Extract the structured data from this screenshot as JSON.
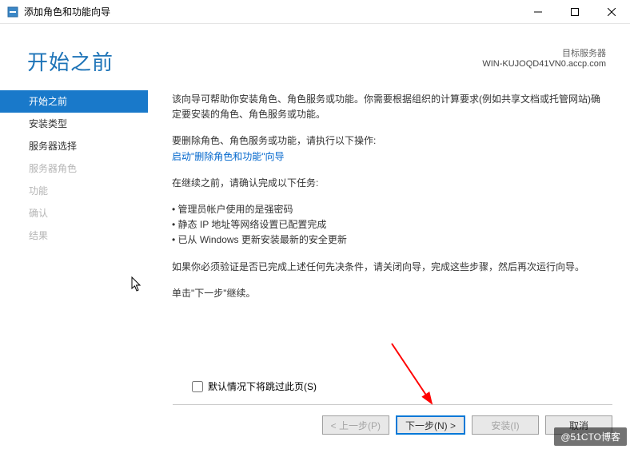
{
  "window": {
    "title": "添加角色和功能向导"
  },
  "header": {
    "page_title": "开始之前",
    "server_label": "目标服务器",
    "server_name": "WIN-KUJOQD41VN0.accp.com"
  },
  "sidebar": {
    "items": [
      {
        "label": "开始之前",
        "state": "active"
      },
      {
        "label": "安装类型",
        "state": "normal"
      },
      {
        "label": "服务器选择",
        "state": "normal"
      },
      {
        "label": "服务器角色",
        "state": "disabled"
      },
      {
        "label": "功能",
        "state": "disabled"
      },
      {
        "label": "确认",
        "state": "disabled"
      },
      {
        "label": "结果",
        "state": "disabled"
      }
    ]
  },
  "content": {
    "intro": "该向导可帮助你安装角色、角色服务或功能。你需要根据组织的计算要求(例如共享文档或托管网站)确定要安装的角色、角色服务或功能。",
    "remove_label": "要删除角色、角色服务或功能，请执行以下操作:",
    "remove_link": "启动\"删除角色和功能\"向导",
    "confirm_label": "在继续之前，请确认完成以下任务:",
    "bullets": [
      "管理员帐户使用的是强密码",
      "静态 IP 地址等网络设置已配置完成",
      "已从 Windows 更新安装最新的安全更新"
    ],
    "verify": "如果你必须验证是否已完成上述任何先决条件，请关闭向导，完成这些步骤，然后再次运行向导。",
    "next_hint": "单击\"下一步\"继续。",
    "skip_checkbox": "默认情况下将跳过此页(S)"
  },
  "footer": {
    "prev": "< 上一步(P)",
    "next": "下一步(N) >",
    "install": "安装(I)",
    "cancel": "取消"
  },
  "watermark": "@51CTO博客"
}
